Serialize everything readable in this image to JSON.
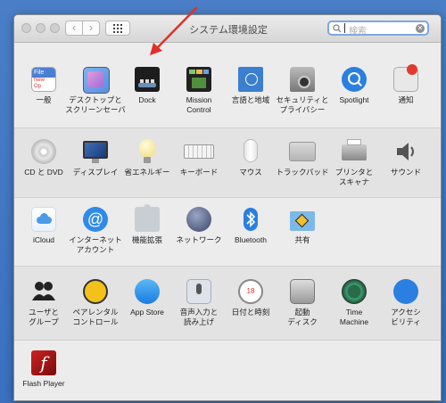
{
  "window": {
    "title": "システム環境設定",
    "search_placeholder": "検索",
    "clear_search_symbol": "✕",
    "nav_back_symbol": "‹",
    "nav_forward_symbol": "›"
  },
  "rows": [
    [
      {
        "id": "general",
        "label": "一般",
        "icon": "general-icon",
        "icon_text_top": "File",
        "icon_text_mid": "New",
        "icon_text_bot": "Op"
      },
      {
        "id": "desktop",
        "label": "デスクトップと\nスクリーンセーバ",
        "icon": "desktop-screensaver-icon"
      },
      {
        "id": "dock",
        "label": "Dock",
        "icon": "dock-icon"
      },
      {
        "id": "mission",
        "label": "Mission\nControl",
        "icon": "mission-control-icon"
      },
      {
        "id": "language",
        "label": "言語と地域",
        "icon": "language-region-icon"
      },
      {
        "id": "security",
        "label": "セキュリティと\nプライバシー",
        "icon": "security-privacy-icon"
      },
      {
        "id": "spotlight",
        "label": "Spotlight",
        "icon": "spotlight-icon"
      },
      {
        "id": "notifications",
        "label": "通知",
        "icon": "notifications-icon"
      }
    ],
    [
      {
        "id": "cd",
        "label": "CD と DVD",
        "icon": "cd-dvd-icon"
      },
      {
        "id": "display",
        "label": "ディスプレイ",
        "icon": "display-icon"
      },
      {
        "id": "energy",
        "label": "省エネルギー",
        "icon": "energy-saver-icon"
      },
      {
        "id": "keyboard",
        "label": "キーボード",
        "icon": "keyboard-icon"
      },
      {
        "id": "mouse",
        "label": "マウス",
        "icon": "mouse-icon"
      },
      {
        "id": "trackpad",
        "label": "トラックパッド",
        "icon": "trackpad-icon"
      },
      {
        "id": "printer",
        "label": "プリンタと\nスキャナ",
        "icon": "printer-scanner-icon"
      },
      {
        "id": "sound",
        "label": "サウンド",
        "icon": "sound-icon"
      }
    ],
    [
      {
        "id": "icloud",
        "label": "iCloud",
        "icon": "icloud-icon"
      },
      {
        "id": "internet",
        "label": "インターネット\nアカウント",
        "icon": "internet-accounts-icon",
        "icon_text": "@"
      },
      {
        "id": "extensions",
        "label": "機能拡張",
        "icon": "extensions-icon"
      },
      {
        "id": "network",
        "label": "ネットワーク",
        "icon": "network-icon"
      },
      {
        "id": "bluetooth",
        "label": "Bluetooth",
        "icon": "bluetooth-icon"
      },
      {
        "id": "sharing",
        "label": "共有",
        "icon": "sharing-icon"
      }
    ],
    [
      {
        "id": "users",
        "label": "ユーザと\nグループ",
        "icon": "users-groups-icon"
      },
      {
        "id": "parental",
        "label": "ペアレンタル\nコントロール",
        "icon": "parental-controls-icon"
      },
      {
        "id": "appstore",
        "label": "App Store",
        "icon": "app-store-icon"
      },
      {
        "id": "dictation",
        "label": "音声入力と\n読み上げ",
        "icon": "dictation-speech-icon"
      },
      {
        "id": "datetime",
        "label": "日付と時刻",
        "icon": "date-time-icon",
        "icon_text": "18"
      },
      {
        "id": "startup",
        "label": "起動\nディスク",
        "icon": "startup-disk-icon"
      },
      {
        "id": "timemachine",
        "label": "Time\nMachine",
        "icon": "time-machine-icon"
      },
      {
        "id": "accessibility",
        "label": "アクセシ\nビリティ",
        "icon": "accessibility-icon"
      }
    ],
    [
      {
        "id": "flash",
        "label": "Flash Player",
        "icon": "flash-player-icon",
        "icon_text": "f"
      }
    ]
  ],
  "colors": {
    "arrow": "#e0302a",
    "accent": "#3d8ef0"
  }
}
